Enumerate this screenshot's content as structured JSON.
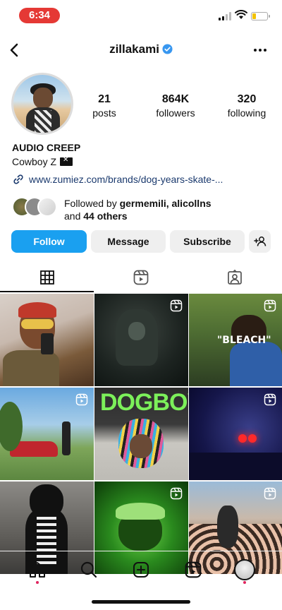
{
  "status_bar": {
    "time": "6:34"
  },
  "header": {
    "username": "zillakami"
  },
  "profile": {
    "stats": [
      {
        "value": "21",
        "label": "posts"
      },
      {
        "value": "864K",
        "label": "followers"
      },
      {
        "value": "320",
        "label": "following"
      }
    ],
    "display_name": "AUDIO CREEP",
    "bio": "Cowboy Z",
    "link": "www.zumiez.com/brands/dog-years-skate-...",
    "followed_by": {
      "prefix": "Followed by ",
      "names": "germemili, alicollns",
      "and": "and ",
      "others": "44 others"
    }
  },
  "actions": {
    "follow": "Follow",
    "message": "Message",
    "subscribe": "Subscribe"
  },
  "grid": {
    "cells": [
      {
        "text": ""
      },
      {
        "text": ""
      },
      {
        "text": "\"BLEACH\""
      },
      {
        "text": ""
      },
      {
        "text": "DOGBOY"
      },
      {
        "text": ""
      },
      {
        "text": ""
      },
      {
        "text": ""
      },
      {
        "text": ""
      }
    ]
  },
  "colors": {
    "follow_blue": "#1aa0f0",
    "time_pill_red": "#e53935",
    "verified_blue": "#3897f0",
    "nav_dot_pink": "#e0245e"
  }
}
